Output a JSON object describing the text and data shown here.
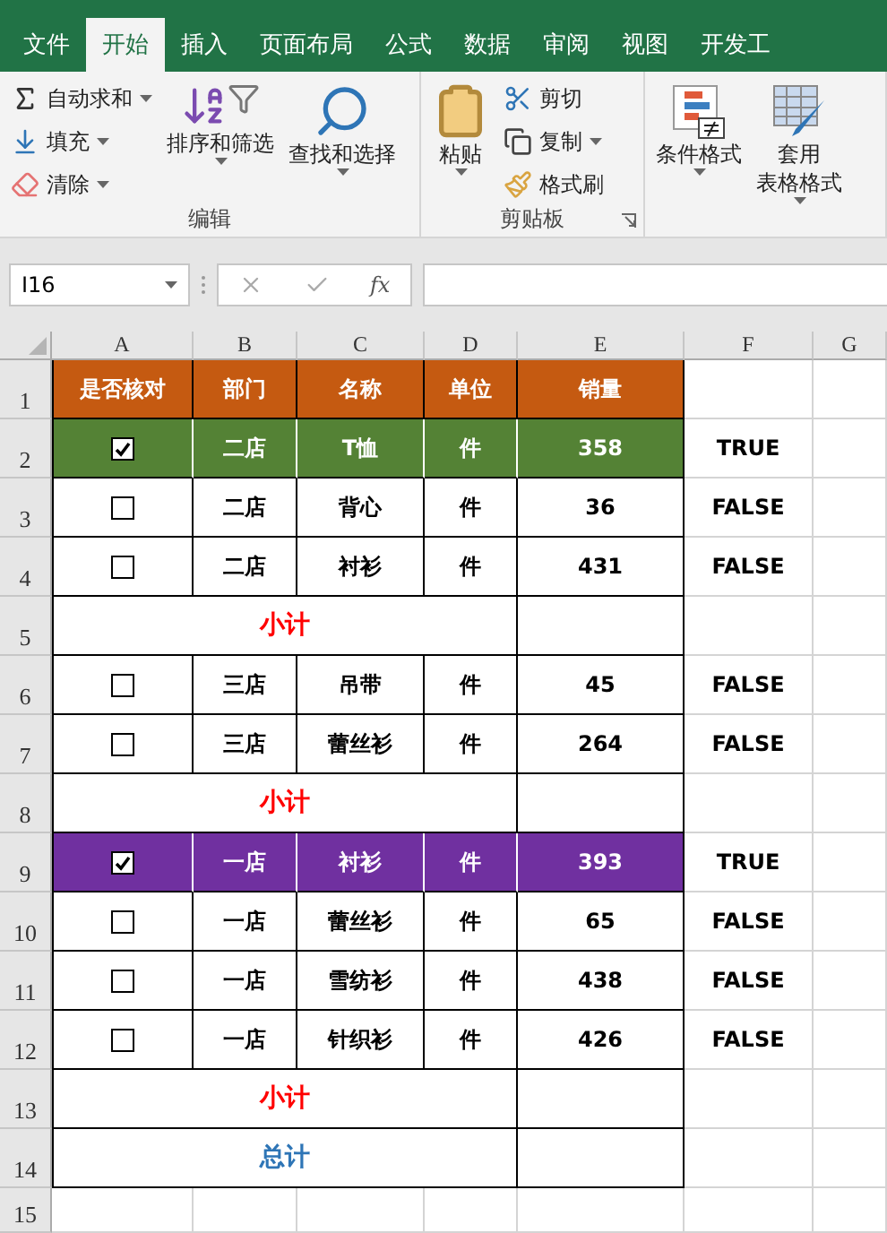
{
  "tabs": [
    {
      "label": "文件",
      "selected": false
    },
    {
      "label": "开始",
      "selected": true
    },
    {
      "label": "插入",
      "selected": false
    },
    {
      "label": "页面布局",
      "selected": false
    },
    {
      "label": "公式",
      "selected": false
    },
    {
      "label": "数据",
      "selected": false
    },
    {
      "label": "审阅",
      "selected": false
    },
    {
      "label": "视图",
      "selected": false
    },
    {
      "label": "开发工",
      "selected": false
    }
  ],
  "ribbon": {
    "groups": [
      {
        "label": "编辑",
        "small": [
          {
            "kind": "sum",
            "label": "自动求和",
            "dropdown": true
          },
          {
            "kind": "fill",
            "label": "填充",
            "dropdown": true
          },
          {
            "kind": "clear",
            "label": "清除",
            "dropdown": true
          }
        ],
        "big": [
          {
            "kind": "sort",
            "lines": [
              "排序和筛选"
            ],
            "dropdown": true
          },
          {
            "kind": "find",
            "lines": [
              "查找和选择"
            ],
            "dropdown": true
          }
        ]
      },
      {
        "label": "剪贴板",
        "launcher": true,
        "big": [
          {
            "kind": "paste",
            "lines": [
              "粘贴"
            ],
            "dropdown": true
          }
        ],
        "small": [
          {
            "kind": "cut",
            "label": "剪切"
          },
          {
            "kind": "copy",
            "label": "复制",
            "dropdown": true
          },
          {
            "kind": "brush",
            "label": "格式刷"
          }
        ]
      },
      {
        "big": [
          {
            "kind": "cond",
            "lines": [
              "条件格式"
            ],
            "dropdown": true
          },
          {
            "kind": "table",
            "lines": [
              "套用",
              "表格格式"
            ],
            "dropdown": true
          }
        ]
      }
    ]
  },
  "formula_bar": {
    "name_box": "I16",
    "fx_label": "fx"
  },
  "columns": [
    "A",
    "B",
    "C",
    "D",
    "E",
    "F",
    "G"
  ],
  "rows": [
    {
      "number": "1",
      "kind": "header",
      "color": "#c55a11",
      "cells": [
        "是否核对",
        "部门",
        "名称",
        "单位",
        "销量"
      ]
    },
    {
      "number": "2",
      "kind": "item",
      "checked": true,
      "color": "#548235",
      "dept": "二店",
      "name": "T恤",
      "unit": "件",
      "qty": "358",
      "result": "TRUE"
    },
    {
      "number": "3",
      "kind": "item",
      "checked": false,
      "color": "#ffffff",
      "dept": "二店",
      "name": "背心",
      "unit": "件",
      "qty": "36",
      "result": "FALSE"
    },
    {
      "number": "4",
      "kind": "item",
      "checked": false,
      "color": "#ffffff",
      "dept": "二店",
      "name": "衬衫",
      "unit": "件",
      "qty": "431",
      "result": "FALSE"
    },
    {
      "number": "5",
      "kind": "subtotal",
      "label": "小计",
      "color": "#ff0000"
    },
    {
      "number": "6",
      "kind": "item",
      "checked": false,
      "color": "#ffffff",
      "dept": "三店",
      "name": "吊带",
      "unit": "件",
      "qty": "45",
      "result": "FALSE"
    },
    {
      "number": "7",
      "kind": "item",
      "checked": false,
      "color": "#ffffff",
      "dept": "三店",
      "name": "蕾丝衫",
      "unit": "件",
      "qty": "264",
      "result": "FALSE"
    },
    {
      "number": "8",
      "kind": "subtotal",
      "label": "小计",
      "color": "#ff0000"
    },
    {
      "number": "9",
      "kind": "item",
      "checked": true,
      "color": "#7030a0",
      "dept": "一店",
      "name": "衬衫",
      "unit": "件",
      "qty": "393",
      "result": "TRUE"
    },
    {
      "number": "10",
      "kind": "item",
      "checked": false,
      "color": "#ffffff",
      "dept": "一店",
      "name": "蕾丝衫",
      "unit": "件",
      "qty": "65",
      "result": "FALSE"
    },
    {
      "number": "11",
      "kind": "item",
      "checked": false,
      "color": "#ffffff",
      "dept": "一店",
      "name": "雪纺衫",
      "unit": "件",
      "qty": "438",
      "result": "FALSE"
    },
    {
      "number": "12",
      "kind": "item",
      "checked": false,
      "color": "#ffffff",
      "dept": "一店",
      "name": "针织衫",
      "unit": "件",
      "qty": "426",
      "result": "FALSE"
    },
    {
      "number": "13",
      "kind": "subtotal",
      "label": "小计",
      "color": "#ff0000"
    },
    {
      "number": "14",
      "kind": "total",
      "label": "总计",
      "color": "#2e75b6"
    },
    {
      "number": "15",
      "kind": "blank"
    }
  ]
}
